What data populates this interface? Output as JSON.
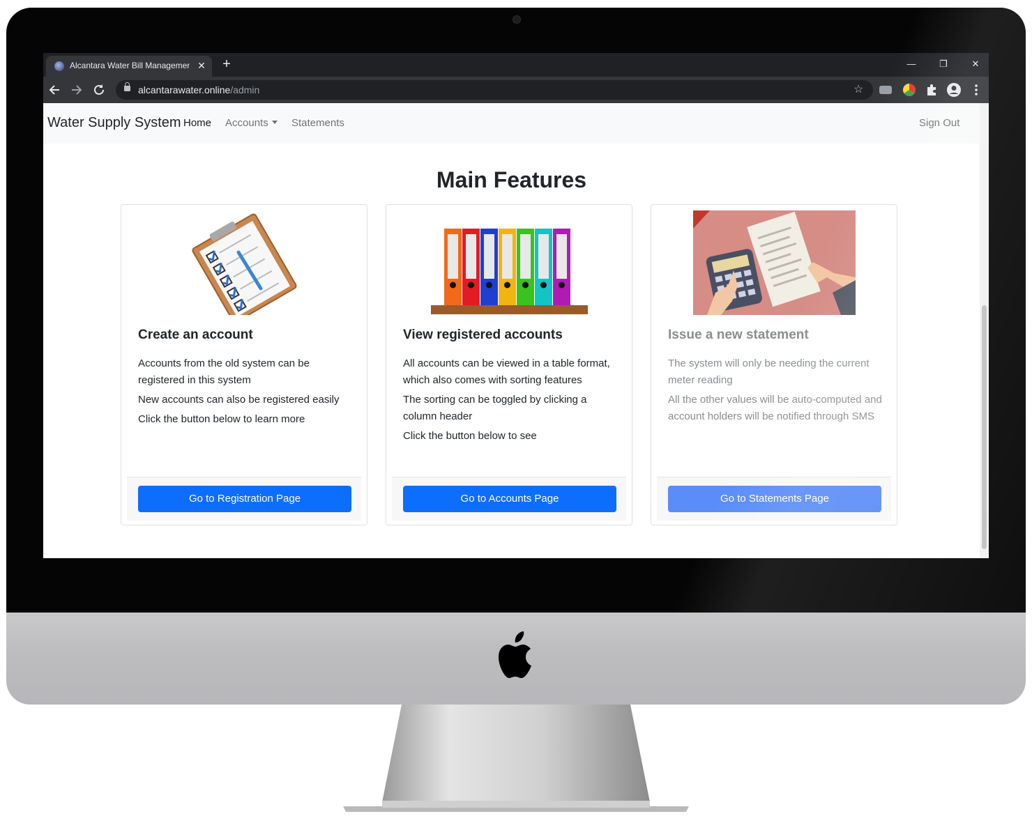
{
  "browser": {
    "tab_title": "Alcantara Water Bill Management",
    "tab_close": "✕",
    "new_tab": "+",
    "url_host": "alcantarawater.online",
    "url_path": "/admin",
    "window_controls": [
      "—",
      "❐",
      "✕"
    ],
    "icons": [
      "back-arrow-icon",
      "forward-arrow-icon",
      "reload-icon",
      "lock-icon",
      "star-icon",
      "extension-icon",
      "profile-icon",
      "menu-icon"
    ]
  },
  "navbar": {
    "brand": "Water Supply System",
    "links": [
      {
        "label": "Home"
      },
      {
        "label": "Accounts"
      },
      {
        "label": "Statements"
      }
    ],
    "sign_out": "Sign Out"
  },
  "main": {
    "title": "Main Features",
    "cards": [
      {
        "title": "Create an account",
        "lines": [
          "Accounts from the old system can be registered in this system",
          "New accounts can also be registered easily",
          "Click the button below to learn more"
        ],
        "button": "Go to Registration Page",
        "image": "clipboard-checklist-icon"
      },
      {
        "title": "View registered accounts",
        "lines": [
          "All accounts can be viewed in a table format, which also comes with sorting features",
          "The sorting can be toggled by clicking a column header",
          "Click the button below to see"
        ],
        "button": "Go to Accounts Page",
        "image": "binders-shelf-icon"
      },
      {
        "title": "Issue a new statement",
        "lines": [
          "The system will only be needing the current meter reading",
          "All the other values will be auto-computed and account holders will be notified through SMS"
        ],
        "button": "Go to Statements Page",
        "image": "calculator-bill-icon"
      }
    ]
  },
  "colors": {
    "primary": "#0d6efd",
    "navbar_bg": "#f8f9fa",
    "chrome_dark": "#202124",
    "chrome_toolbar": "#35363a"
  }
}
